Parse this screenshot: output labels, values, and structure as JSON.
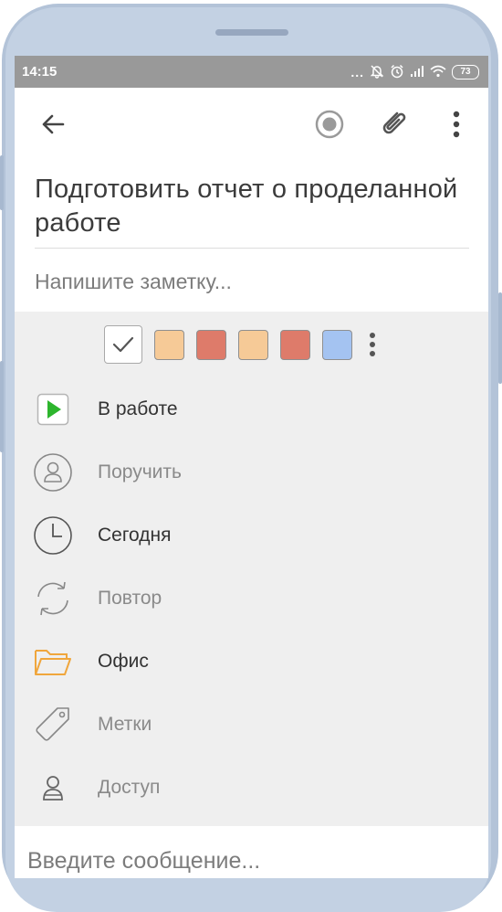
{
  "status_bar": {
    "time": "14:15",
    "dots": "...",
    "battery": "73"
  },
  "toolbar": {
    "back_icon": "arrow-left-icon",
    "focus_icon": "target-circle-icon",
    "attach_icon": "paperclip-icon",
    "more_icon": "vertical-dots-icon"
  },
  "task": {
    "title": "Подготовить отчет о проделанной работе",
    "note_placeholder": "Напишите заметку..."
  },
  "color_picker": {
    "selected": "none",
    "swatches": [
      "#f6ca97",
      "#de7b6a",
      "#f6ca97",
      "#de7b6a",
      "#a4c3f1"
    ]
  },
  "properties": [
    {
      "icon": "play-icon",
      "label": "В работе",
      "active": true
    },
    {
      "icon": "user-icon",
      "label": "Поручить",
      "active": false
    },
    {
      "icon": "clock-icon",
      "label": "Сегодня",
      "active": true
    },
    {
      "icon": "repeat-icon",
      "label": "Повтор",
      "active": false
    },
    {
      "icon": "folder-icon",
      "label": "Офис",
      "active": true
    },
    {
      "icon": "tag-icon",
      "label": "Метки",
      "active": false
    },
    {
      "icon": "person-icon",
      "label": "Доступ",
      "active": false
    }
  ],
  "message": {
    "placeholder": "Введите сообщение..."
  },
  "colors": {
    "accent_green": "#2db52d",
    "folder_orange": "#f0a63c",
    "screen_gray": "#efefef",
    "status_bar": "#999999",
    "phone_frame": "#b3c3d8"
  }
}
